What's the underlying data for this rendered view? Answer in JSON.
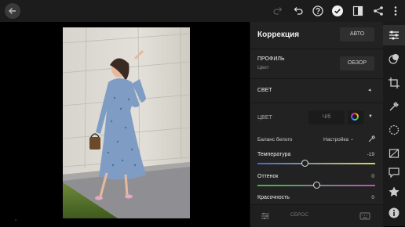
{
  "panel": {
    "title": "Коррекция",
    "auto_label": "АВТО",
    "profile": {
      "label": "ПРОФИЛЬ",
      "value": "Цвет",
      "browse_label": "ОБЗОР"
    },
    "light_label": "СВЕТ",
    "color_label": "ЦВЕТ",
    "bw_label": "Ч/б",
    "white_balance": {
      "label": "Баланс белого",
      "value": "Настройка"
    },
    "sliders": [
      {
        "label": "Температура",
        "value": "-19",
        "level": -0.19
      },
      {
        "label": "Оттенок",
        "value": "0",
        "level": 0
      },
      {
        "label": "Красочность",
        "value": "0",
        "level": 0
      }
    ],
    "reset_label": "СБРОС"
  },
  "icons": {
    "back": "arrow-left-icon",
    "redo": "redo-icon",
    "undo": "undo-icon",
    "help": "help-circle-icon",
    "done": "checkmark-icon",
    "compare": "before-after-icon",
    "share": "share-icon",
    "more": "more-vertical-icon",
    "rail": [
      "sliders-icon",
      "presets-icon",
      "crop-icon",
      "healing-brush-icon",
      "selective-icon",
      "optics-icon",
      "comments-icon",
      "star-icon",
      "info-icon"
    ]
  },
  "colors": {
    "accent": "#ffffff",
    "panel_bg": "#222222",
    "toolbar_bg": "#1c1c1c"
  }
}
